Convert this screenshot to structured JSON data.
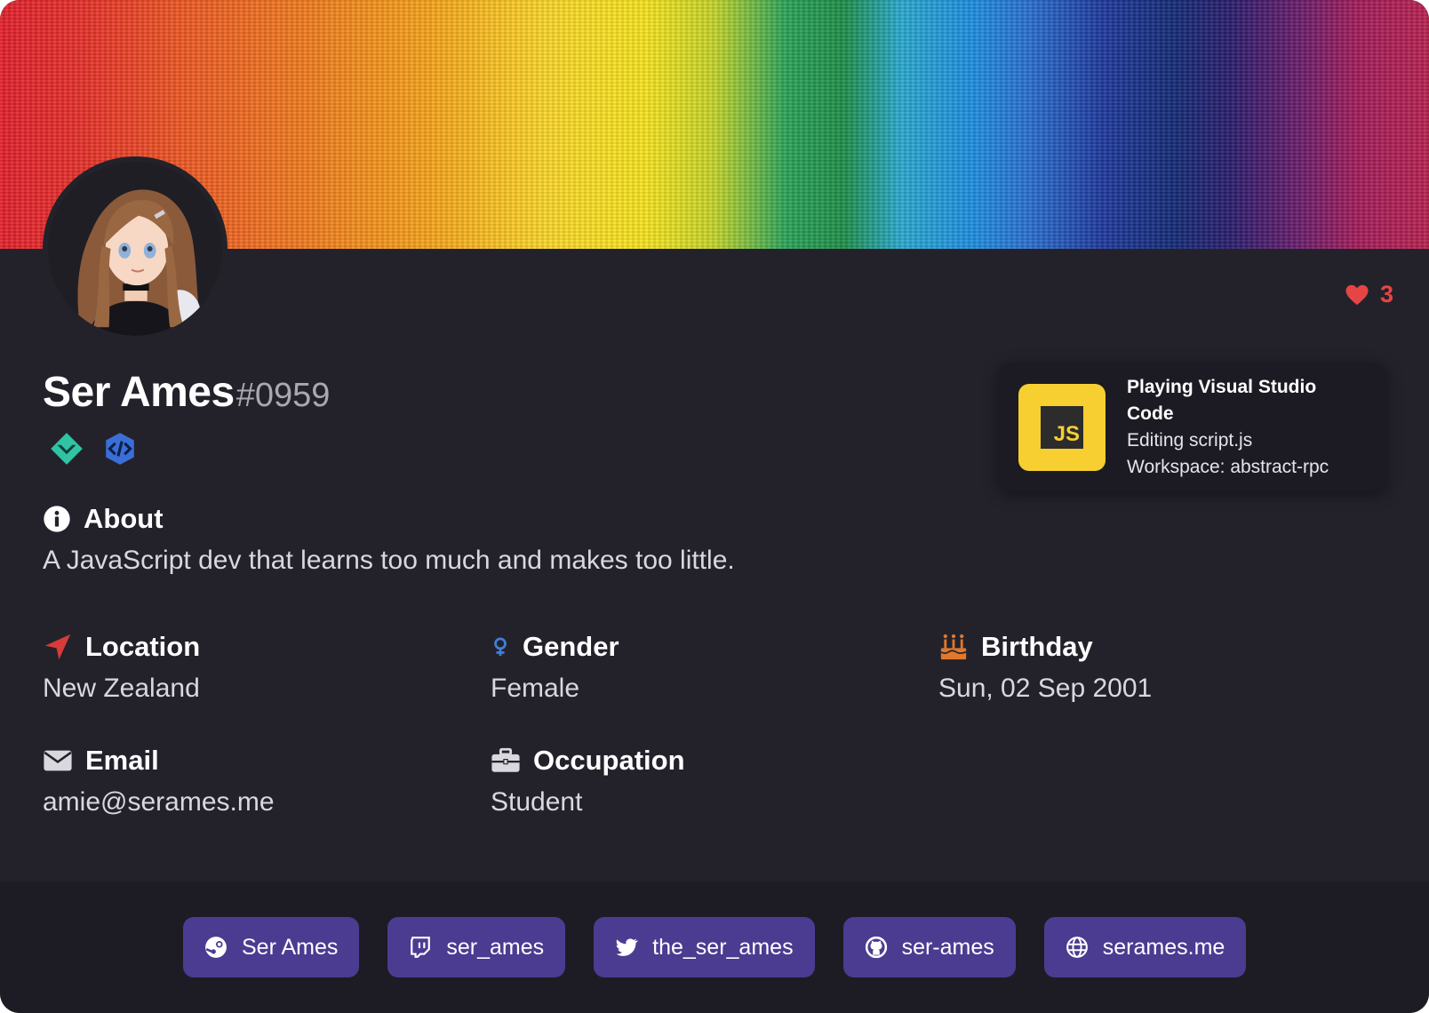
{
  "profile": {
    "name": "Ser Ames",
    "discriminator": "#0959",
    "likes": "3"
  },
  "activity": {
    "icon": "javascript-file-icon",
    "icon_text": "JS",
    "title": "Playing Visual Studio Code",
    "details": "Editing script.js",
    "state": "Workspace: abstract-rpc"
  },
  "about": {
    "label": "About",
    "text": "A JavaScript dev that learns too much and makes too little."
  },
  "info": {
    "location": {
      "label": "Location",
      "value": "New Zealand"
    },
    "gender": {
      "label": "Gender",
      "value": "Female"
    },
    "birthday": {
      "label": "Birthday",
      "value": "Sun, 02 Sep 2001"
    },
    "email": {
      "label": "Email",
      "value": "amie@serames.me"
    },
    "occupation": {
      "label": "Occupation",
      "value": "Student"
    }
  },
  "links": [
    {
      "icon": "steam-icon",
      "label": "Ser Ames"
    },
    {
      "icon": "twitch-icon",
      "label": "ser_ames"
    },
    {
      "icon": "twitter-icon",
      "label": "the_ser_ames"
    },
    {
      "icon": "github-icon",
      "label": "ser-ames"
    },
    {
      "icon": "globe-icon",
      "label": "serames.me"
    }
  ],
  "colors": {
    "card_bg": "#23222b",
    "footer_bg": "#1d1c24",
    "link_button": "#4b3c91",
    "like_red": "#e64545",
    "js_yellow": "#f7cf31",
    "location_red": "#d93a3a",
    "gender_blue": "#3f7fd9",
    "birthday_orange": "#e0782e"
  }
}
